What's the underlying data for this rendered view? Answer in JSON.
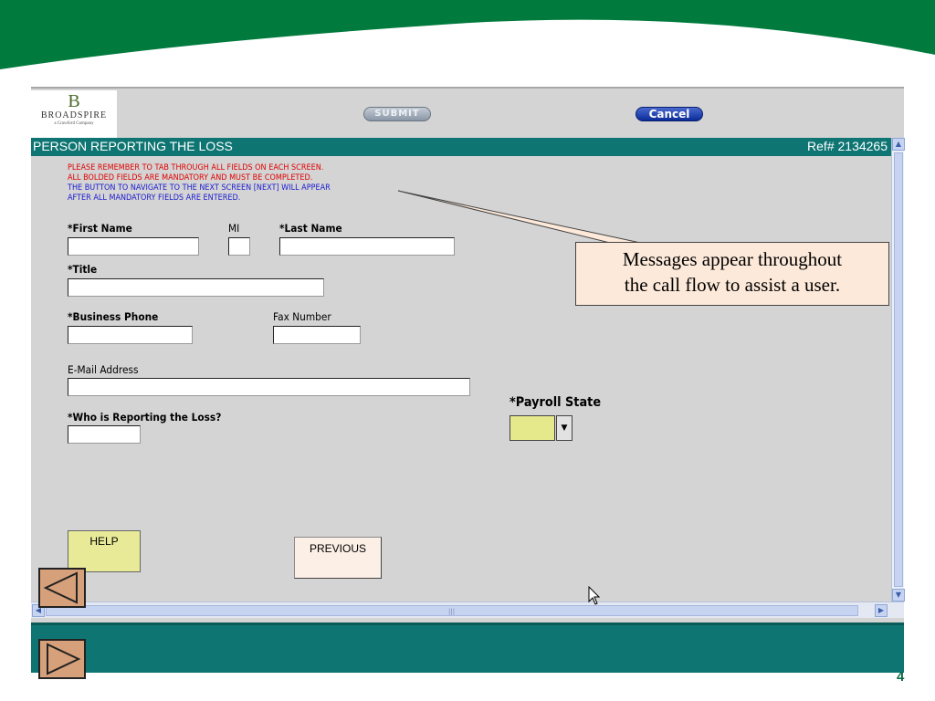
{
  "slide": {
    "page_number": "4"
  },
  "logo": {
    "mark": "B",
    "name": "BROADSPIRE",
    "tagline": "a Crawford Company"
  },
  "toolbar": {
    "submit_label": "SUBMIT",
    "cancel_label": "Cancel"
  },
  "header": {
    "title": "PERSON REPORTING THE LOSS",
    "ref": "Ref# 2134265"
  },
  "messages": {
    "line1": "PLEASE REMEMBER TO TAB THROUGH ALL FIELDS ON EACH SCREEN.",
    "line2": "ALL BOLDED FIELDS ARE MANDATORY AND MUST BE COMPLETED.",
    "line3": "THE BUTTON TO NAVIGATE TO THE NEXT SCREEN [NEXT] WILL APPEAR",
    "line4": "AFTER ALL MANDATORY FIELDS ARE ENTERED."
  },
  "fields": {
    "first_name": {
      "label": "*First Name",
      "value": ""
    },
    "mi": {
      "label": "MI",
      "value": ""
    },
    "last_name": {
      "label": "*Last Name",
      "value": ""
    },
    "title": {
      "label": "*Title",
      "value": ""
    },
    "business_phone": {
      "label": "*Business Phone",
      "value": ""
    },
    "fax_number": {
      "label": "Fax Number",
      "value": ""
    },
    "email": {
      "label": "E-Mail Address",
      "value": ""
    },
    "who_reporting": {
      "label": "*Who is Reporting the Loss?",
      "value": ""
    },
    "payroll_state": {
      "label": "*Payroll State",
      "value": ""
    }
  },
  "buttons": {
    "help_label": "HELP",
    "previous_label": "PREVIOUS"
  },
  "callout": {
    "line1": "Messages appear throughout",
    "line2": "the call flow to assist a user."
  },
  "colors": {
    "teal": "#0e7573",
    "slide_green": "#007a3d",
    "required_select_bg": "#e6e88c",
    "message_red": "#e00000",
    "message_blue": "#1a1ad0"
  }
}
